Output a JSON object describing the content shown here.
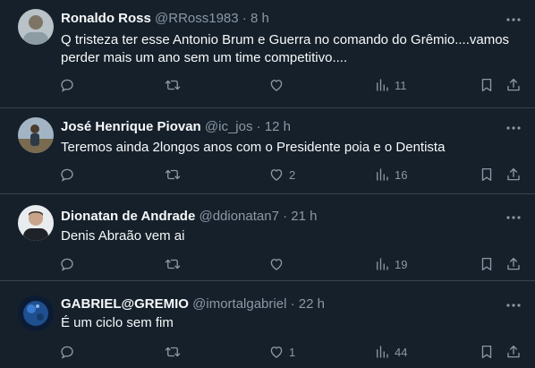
{
  "tweets": [
    {
      "name": "Ronaldo Ross",
      "handle": "@RRoss1983",
      "dot": "·",
      "time": "8 h",
      "text_line1": "Q tristeza ter esse Antonio Brum e Guerra no comando do Grêmio....vamos",
      "text_line2": "perder mais um ano sem um time competitivo....",
      "likes": "",
      "views": "11"
    },
    {
      "name": "José Henrique Piovan",
      "handle": "@ic_jos",
      "dot": "·",
      "time": "12 h",
      "text_line1": "Teremos ainda 2longos anos com o Presidente poia e o Dentista",
      "likes": "2",
      "views": "16"
    },
    {
      "name": "Dionatan de Andrade",
      "handle": "@ddionatan7",
      "dot": "·",
      "time": "21 h",
      "text_line1": "Denis Abraão vem ai",
      "likes": "",
      "views": "19"
    },
    {
      "name": "GABRIEL@GREMIO",
      "handle": "@imortalgabriel",
      "dot": "·",
      "time": "22 h",
      "text_line1": "É um ciclo sem fim",
      "likes": "1",
      "views": "44"
    }
  ],
  "icons": {
    "reply": "reply-icon",
    "retweet": "retweet-icon",
    "like": "heart-icon",
    "views": "views-icon",
    "bookmark": "bookmark-icon",
    "share": "share-icon",
    "more": "more-icon"
  },
  "colors": {
    "background": "#15202b",
    "text": "#f7f9f9",
    "secondary": "#8b98a5",
    "divider": "#38444d"
  }
}
